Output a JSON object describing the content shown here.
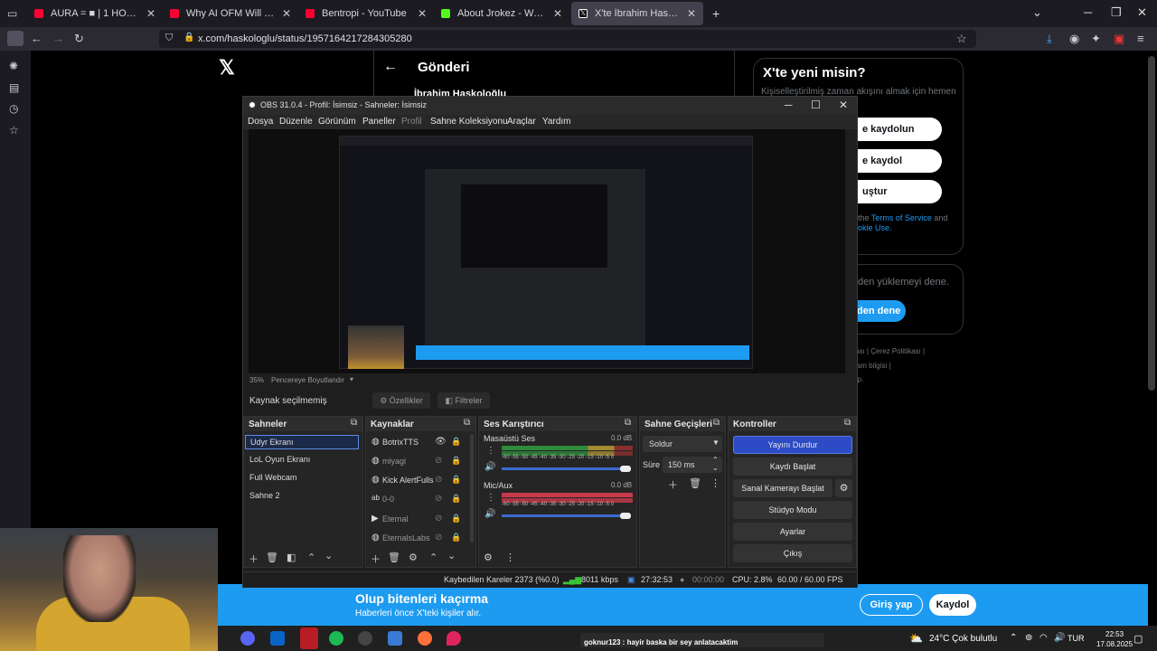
{
  "browser": {
    "tabs": [
      {
        "label": "AURA = ■ | 1 HOUR AURA M",
        "color": "#ff0033",
        "active": false
      },
      {
        "label": "Why AI OFM Will Make EVERYO",
        "color": "#ff0033",
        "active": false
      },
      {
        "label": "Bentropi - YouTube",
        "color": "#ff0033",
        "active": false
      },
      {
        "label": "About Jrokez - Watch Live on K",
        "color": "#53fc18",
        "active": false
      },
      {
        "label": "X'te İbrahim Haskoloğlu: \"Oğuz",
        "color": "#ffffff",
        "active": true
      }
    ],
    "new_tab": "+",
    "url": "x.com/haskologlu/status/1957164217284305280",
    "icons": {
      "back": "back-icon",
      "forward": "forward-icon",
      "reload": "reload-icon"
    }
  },
  "x": {
    "page_title": "Gönderi",
    "author": "İbrahim Haskoloğlu",
    "new_title": "X'te yeni misin?",
    "new_sub": "Kişiselleştirilmiş zaman akışını almak için hemen",
    "signup_google": "e kaydolun",
    "signup_apple": "e kaydol",
    "create_account": "uştur",
    "terms_a": "the",
    "terms_link": "Terms of Service",
    "terms_b": "and",
    "cookie": "okie Use.",
    "retry_text": "den yüklemeyi dene.",
    "retry_btn": "den dene",
    "footer1": "ası   |   Çerez Politikası   |",
    "footer2": "lam bilgisi   |",
    "footer3": "rp.",
    "banner_title": "Olup bitenleri kaçırma",
    "banner_sub": "Haberleri önce X'teki kişiler alır.",
    "login": "Giriş yap",
    "signup": "Kaydol"
  },
  "obs": {
    "title": "OBS 31.0.4 - Profil: İsimsiz - Sahneler: İsimsiz",
    "menu": [
      "Dosya",
      "Düzenle",
      "Görünüm",
      "Paneller",
      "Profil",
      "Sahne Koleksiyonu",
      "Araçlar",
      "Yardım"
    ],
    "zoom": "35%",
    "fit": "Pencereye Boyutlandır",
    "no_source": "Kaynak seçilmemiş",
    "properties": "Özellikler",
    "filters": "Filtreler",
    "docks": {
      "scenes": "Sahneler",
      "sources": "Kaynaklar",
      "mixer": "Ses Karıştırıcı",
      "transitions": "Sahne Geçişleri",
      "controls": "Kontroller"
    },
    "scenes": [
      "Udyr Ekranı",
      "LoL Oyun Ekranı",
      "Full Webcam",
      "Sahne 2"
    ],
    "sources": [
      "BotrixTTS",
      "miyagi",
      "Kick AlertFulls",
      "0-0",
      "Eternal",
      "EternalsLabs"
    ],
    "mixer": [
      {
        "name": "Masaüstü Ses",
        "db": "0.0 dB"
      },
      {
        "name": "Mic/Aux",
        "db": "0.0 dB"
      }
    ],
    "meter_scale": "-60 -55 -50 -45 -40 -35 -30 -25 -20 -15 -10 -5 0",
    "transition": "Soldur",
    "duration_label": "Süre",
    "duration": "150 ms",
    "controls": [
      "Yayını Durdur",
      "Kaydı Başlat",
      "Sanal Kamerayı Başlat",
      "Stüdyo Modu",
      "Ayarlar",
      "Çıkış"
    ],
    "status": {
      "dropped": "Kaybedilen Kareler 2373 (%0.0)",
      "bitrate": "8011 kbps",
      "live_time": "27:32:53",
      "rec_time": "00:00:00",
      "cpu": "CPU: 2.8%",
      "fps": "60.00 / 60.00 FPS"
    }
  },
  "taskbar": {
    "chat": "goknur123 : hayir baska bir sey anlatacaktim",
    "weather": "24°C  Çok bulutlu",
    "lang": "TUR",
    "time": "22:53",
    "date": "17.08.2025"
  }
}
